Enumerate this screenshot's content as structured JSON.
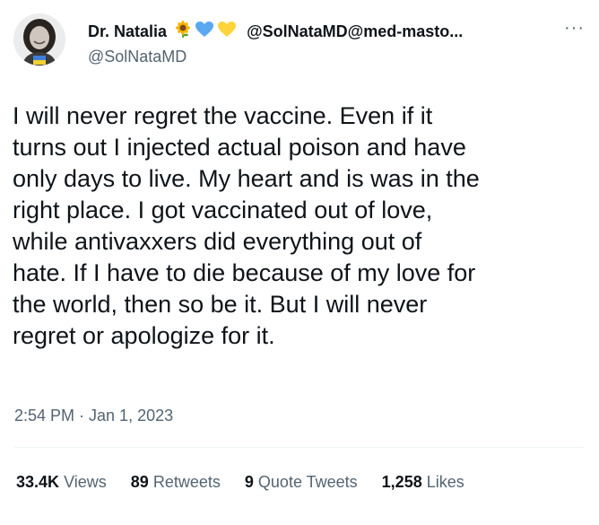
{
  "author": {
    "display_name": "Dr. Natalia",
    "name_emojis": [
      "sunflower-emoji",
      "blue-heart-emoji",
      "yellow-heart-emoji"
    ],
    "mastodon_handle": "@SolNataMD@med-masto...",
    "handle": "@SolNataMD"
  },
  "tweet": {
    "text": "I will never regret the vaccine. Even if it\nturns out I injected actual poison and have\nonly days to live. My heart and is was in the\nright place. I got vaccinated out of love,\nwhile antivaxxers did everything out of\nhate. If I have to die because of my love for\nthe world, then so be it. But I will never\nregret or apologize for it.",
    "timestamp": "2:54 PM · Jan 1, 2023"
  },
  "more_label": "···",
  "stats": {
    "views_count": "33.4K",
    "views_label": "Views",
    "retweets_count": "89",
    "retweets_label": "Retweets",
    "quotes_count": "9",
    "quotes_label": "Quote Tweets",
    "likes_count": "1,258",
    "likes_label": "Likes"
  },
  "colors": {
    "text_primary": "#0f1419",
    "text_secondary": "#536471",
    "divider": "#eff3f4",
    "blue_heart": "#5aa8f0",
    "yellow_heart": "#ffd43b"
  }
}
